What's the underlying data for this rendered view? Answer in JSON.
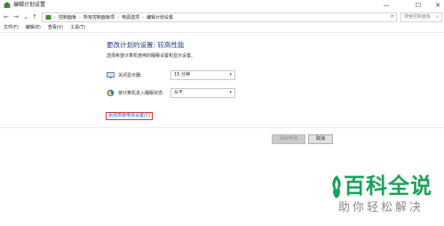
{
  "window": {
    "title": "编辑计划设置",
    "minimize": "—",
    "maximize": "☐",
    "close": "✕"
  },
  "nav": {
    "back": "←",
    "forward": "→",
    "recent": "⌄",
    "up": "↑",
    "breadcrumb": [
      "控制面板",
      "所有控制面板项",
      "电源选项",
      "编辑计划设置"
    ],
    "separator": "›",
    "refresh": "⟳",
    "search_placeholder": "搜索控制面板",
    "search_icon": "⌕"
  },
  "menu": [
    "文件(F)",
    "编辑(E)",
    "查看(V)",
    "工具(T)"
  ],
  "main": {
    "heading": "更改计划的设置: 较高性能",
    "subtext": "选择希望计算机使用的睡眠设置和显示设置。",
    "settings": [
      {
        "icon": "display-icon",
        "label": "关闭显示器:",
        "value": "15 分钟"
      },
      {
        "icon": "sleep-icon",
        "label": "使计算机进入睡眠状态:",
        "value": "从不"
      }
    ],
    "advanced_link": "更改高级电源设置(C)"
  },
  "buttons": {
    "save": "保存修改",
    "cancel": "取消"
  },
  "watermark": {
    "title": "百科全说",
    "subtitle": "助你轻松解决"
  },
  "colors": {
    "heading": "#1e3b8a",
    "link": "#1a56c5",
    "highlight_border": "#e0392b",
    "watermark_green": "#19a15a"
  }
}
